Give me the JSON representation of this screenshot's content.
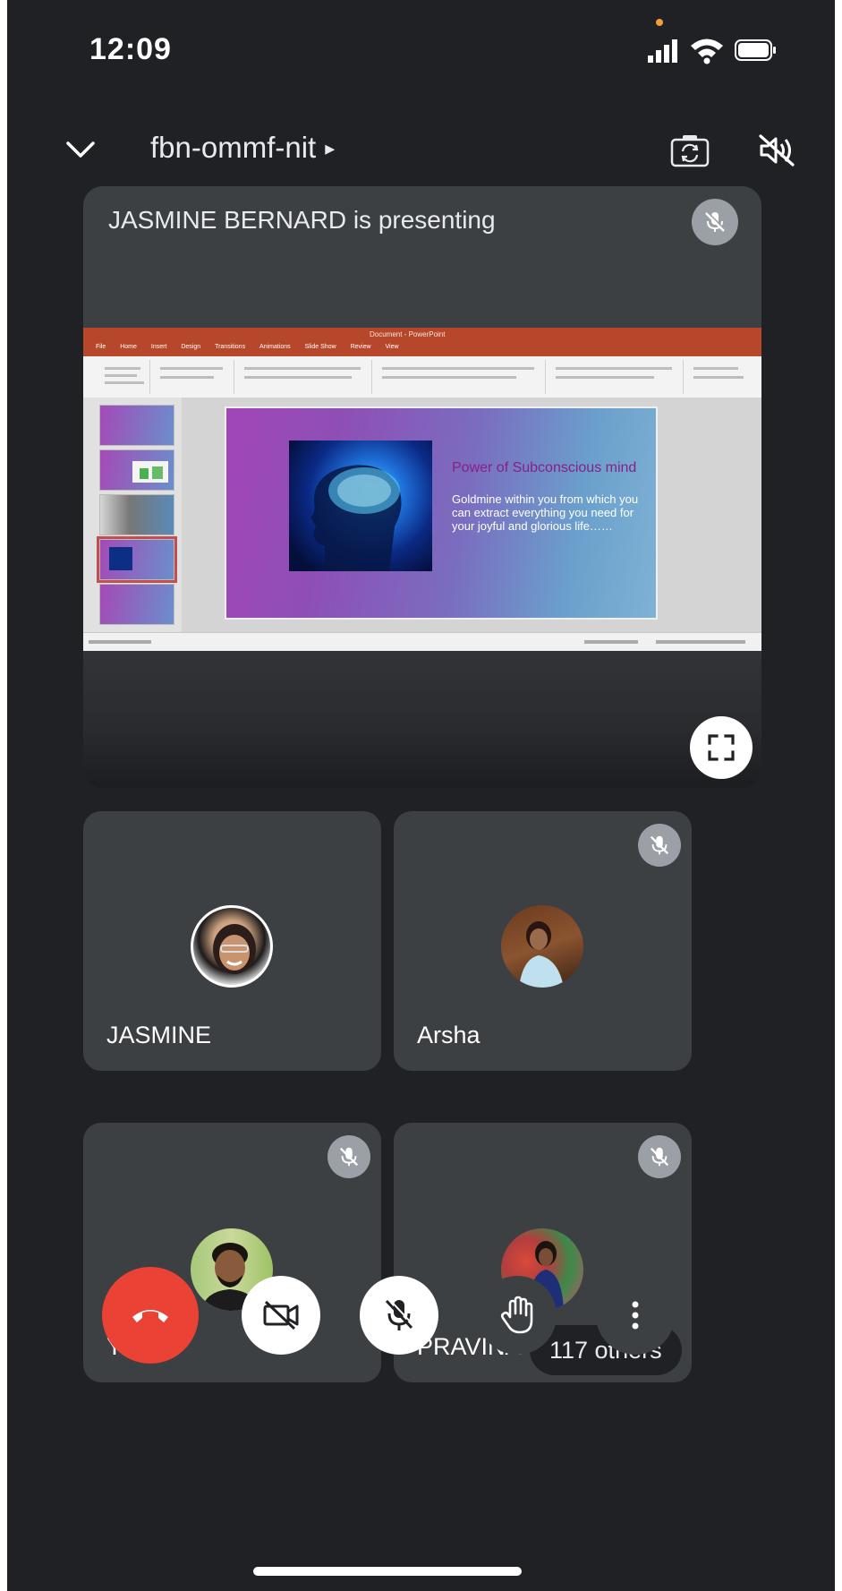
{
  "status_bar": {
    "time": "12:09"
  },
  "header": {
    "meeting_code": "fbn-ommf-nit",
    "arrow": "▸"
  },
  "presentation": {
    "label": "JASMINE BERNARD is presenting",
    "slide": {
      "app_title": "Document - PowerPoint",
      "tabs": [
        "File",
        "Home",
        "Insert",
        "Design",
        "Transitions",
        "Animations",
        "Slide Show",
        "Review",
        "View"
      ],
      "title": "Power of Subconscious mind",
      "body": "Goldmine within you from which you can extract everything you need for your joyful and glorious life……"
    }
  },
  "participants": [
    {
      "name": "JASMINE",
      "muted": false
    },
    {
      "name": "Arsha",
      "muted": true
    },
    {
      "name": "You",
      "muted": true
    },
    {
      "name": "PRAVINA",
      "muted": true
    }
  ],
  "others_label": "117 others",
  "controls": {
    "end_call": {
      "color": "#ea4335",
      "icon": "phone-hangup-icon"
    },
    "camera": {
      "state": "off",
      "icon": "video-off-icon"
    },
    "microphone": {
      "state": "off",
      "icon": "mic-off-icon"
    },
    "raise_hand": {
      "icon": "hand-icon"
    },
    "more": {
      "icon": "more-vert-icon"
    }
  },
  "colors": {
    "background": "#202124",
    "tile": "#3c4043",
    "end_call": "#ea4335",
    "mute_badge": "#9aa0a6"
  }
}
